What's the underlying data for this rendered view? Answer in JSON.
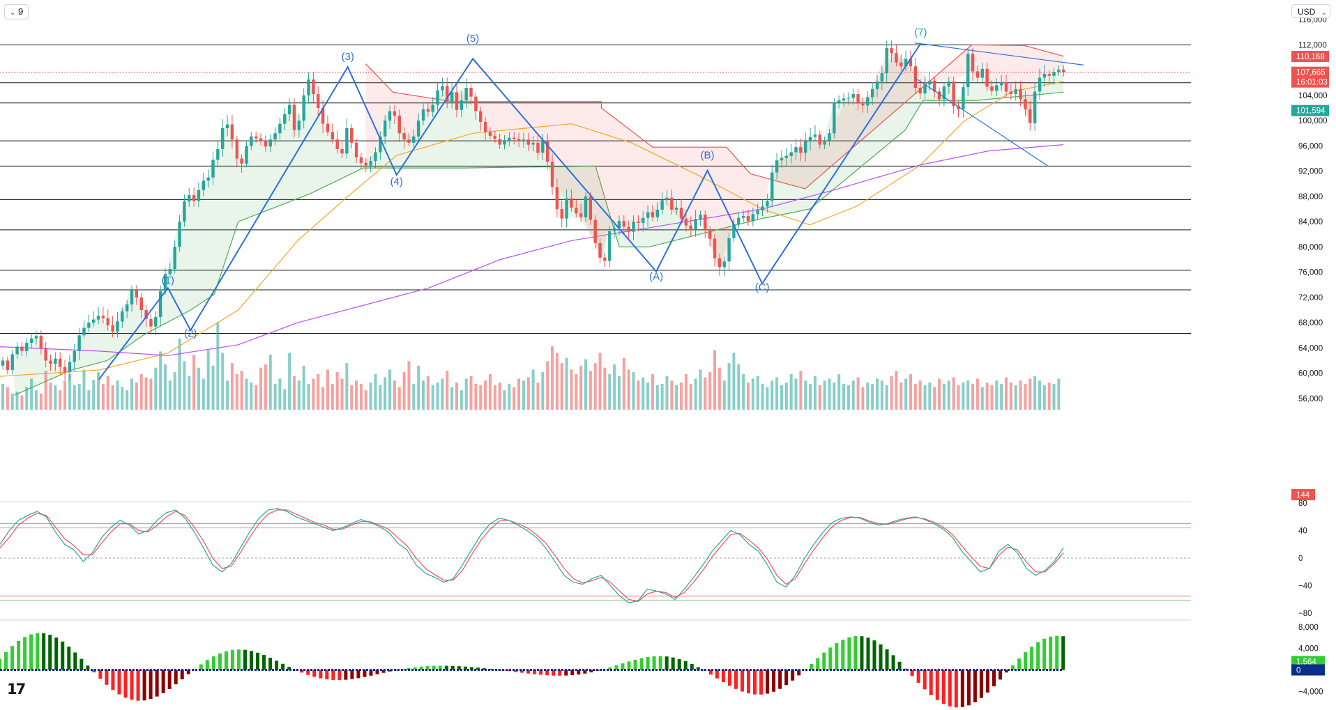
{
  "toolbar": {
    "interval_label": "9",
    "currency_label": "USD"
  },
  "brand": {
    "logo_text": "17"
  },
  "colors": {
    "up": "#26a69a",
    "down": "#ef5350",
    "wave_lines": "#2a6fdb",
    "ma_orange": "#f5a623",
    "ma_purple": "#b84dff",
    "stop_green": "#4caf50",
    "stop_red": "#ef5350",
    "macd_up_strong": "#006400",
    "macd_up": "#32cd32",
    "macd_down_strong": "#8b0000",
    "macd_down": "#ff2020"
  },
  "chart_data": [
    {
      "type": "candlestick",
      "title": "",
      "ylabel": "",
      "ylim": [
        54000,
        118000
      ],
      "y_ticks": [
        "116,000",
        "112,000",
        "108,000",
        "104,000",
        "100,000",
        "96,000",
        "92,000",
        "88,000",
        "84,000",
        "80,000",
        "76,000",
        "72,000",
        "68,000",
        "64,000",
        "60,000",
        "56,000"
      ],
      "horizontal_levels": [
        112000,
        106000,
        102800,
        96800,
        92800,
        87500,
        82700,
        76300,
        73200,
        66300
      ],
      "price_tags": [
        {
          "label": "110,168",
          "value": 110168,
          "color": "#ef5350"
        },
        {
          "label": "107,665",
          "sub_label": "16:01:03",
          "value": 107665,
          "color": "#ef5350"
        },
        {
          "label": "101,594",
          "value": 101594,
          "color": "#26a69a"
        },
        {
          "label": "144",
          "value": 55000,
          "color": "#ef5350"
        }
      ],
      "wave_labels": [
        {
          "label": "(1)",
          "x": 0.141,
          "value": 74200
        },
        {
          "label": "(2)",
          "x": 0.16,
          "value": 65800
        },
        {
          "label": "(3)",
          "x": 0.292,
          "value": 109600
        },
        {
          "label": "(4)",
          "x": 0.333,
          "value": 89800
        },
        {
          "label": "(5)",
          "x": 0.397,
          "value": 112500
        },
        {
          "label": "(A)",
          "x": 0.551,
          "value": 74800
        },
        {
          "label": "(B)",
          "x": 0.594,
          "value": 94000
        },
        {
          "label": "(C)",
          "x": 0.64,
          "value": 73100
        },
        {
          "label": "(7)",
          "x": 0.773,
          "value": 113500
        }
      ],
      "wave_path": [
        [
          0.083,
          59000
        ],
        [
          0.141,
          73500
        ],
        [
          0.16,
          66800
        ],
        [
          0.292,
          108500
        ],
        [
          0.333,
          91400
        ],
        [
          0.397,
          109800
        ],
        [
          0.551,
          76100
        ],
        [
          0.594,
          92100
        ],
        [
          0.64,
          74200
        ],
        [
          0.773,
          112200
        ]
      ],
      "closes": [
        62000,
        60500,
        63000,
        64200,
        63500,
        64800,
        65500,
        65900,
        64000,
        62000,
        61500,
        62300,
        61000,
        60200,
        61800,
        63500,
        66000,
        67200,
        68000,
        68500,
        69100,
        68700,
        67600,
        66600,
        68200,
        69800,
        70900,
        73200,
        72000,
        70000,
        68600,
        67400,
        68900,
        73000,
        75700,
        76500,
        80000,
        84000,
        87200,
        88200,
        87300,
        89000,
        90500,
        91000,
        93800,
        95500,
        98800,
        99400,
        97000,
        94000,
        93200,
        96000,
        97500,
        97200,
        96800,
        95900,
        97000,
        98000,
        99500,
        101000,
        102500,
        98500,
        100000,
        104000,
        106500,
        104200,
        102000,
        99500,
        98200,
        97000,
        95500,
        94800,
        98800,
        96500,
        94200,
        93300,
        92900,
        93600,
        95000,
        97500,
        100000,
        101500,
        100800,
        98000,
        97000,
        96500,
        97500,
        100000,
        101800,
        101400,
        102500,
        104800,
        105500,
        103000,
        104500,
        101700,
        103200,
        105200,
        103800,
        101500,
        99800,
        98200,
        97600,
        97100,
        96200,
        96800,
        97300,
        97100,
        96700,
        97000,
        96200,
        96500,
        94900,
        96700,
        93500,
        89500,
        86000,
        84500,
        87700,
        86200,
        85300,
        84700,
        88000,
        84300,
        80600,
        78300,
        77800,
        82500,
        83000,
        84100,
        83200,
        82400,
        84000,
        83800,
        84600,
        85500,
        84700,
        85900,
        87400,
        87800,
        85900,
        86200,
        84500,
        83400,
        82700,
        84400,
        85100,
        82600,
        81300,
        78200,
        76800,
        77700,
        81400,
        83600,
        84600,
        84900,
        84100,
        85200,
        85800,
        86400,
        87300,
        91800,
        93700,
        94100,
        94400,
        95000,
        95800,
        94900,
        96700,
        97400,
        97800,
        96200,
        96800,
        98000,
        102800,
        103200,
        103500,
        103600,
        104200,
        102700,
        102400,
        103700,
        105000,
        106200,
        107500,
        111500,
        110700,
        109200,
        108600,
        109800,
        108600,
        105200,
        104300,
        105700,
        106300,
        104600,
        103400,
        105400,
        106200,
        102300,
        101800,
        105300,
        110600,
        107800,
        106800,
        108200,
        105400,
        104700,
        105600,
        106100,
        104600,
        104200,
        105000,
        103400,
        101800,
        99600,
        104600,
        106800,
        107400,
        107100,
        107700,
        108100,
        107665
      ],
      "ma_orange": [
        [
          0.0,
          59500
        ],
        [
          0.083,
          60500
        ],
        [
          0.141,
          63200
        ],
        [
          0.2,
          70000
        ],
        [
          0.25,
          81000
        ],
        [
          0.292,
          88000
        ],
        [
          0.333,
          94500
        ],
        [
          0.397,
          98000
        ],
        [
          0.48,
          99500
        ],
        [
          0.53,
          96500
        ],
        [
          0.59,
          91000
        ],
        [
          0.64,
          86000
        ],
        [
          0.68,
          83500
        ],
        [
          0.72,
          86500
        ],
        [
          0.773,
          93000
        ],
        [
          0.81,
          100000
        ],
        [
          0.85,
          104600
        ],
        [
          0.893,
          106200
        ]
      ],
      "ma_purple": [
        [
          0.0,
          64200
        ],
        [
          0.083,
          63500
        ],
        [
          0.141,
          62800
        ],
        [
          0.2,
          64500
        ],
        [
          0.25,
          68000
        ],
        [
          0.3,
          70500
        ],
        [
          0.36,
          73500
        ],
        [
          0.42,
          78000
        ],
        [
          0.48,
          81000
        ],
        [
          0.56,
          83500
        ],
        [
          0.64,
          86000
        ],
        [
          0.7,
          89000
        ],
        [
          0.773,
          93000
        ],
        [
          0.83,
          95200
        ],
        [
          0.893,
          96200
        ]
      ],
      "volume_ylim": [
        0,
        200000
      ],
      "volumes": [
        40,
        35,
        25,
        28,
        22,
        35,
        48,
        30,
        25,
        60,
        42,
        38,
        30,
        45,
        55,
        38,
        40,
        62,
        30,
        46,
        58,
        40,
        52,
        38,
        45,
        35,
        30,
        48,
        42,
        55,
        50,
        48,
        65,
        90,
        70,
        45,
        58,
        110,
        75,
        52,
        85,
        65,
        48,
        92,
        68,
        135,
        88,
        45,
        72,
        55,
        60,
        48,
        42,
        38,
        65,
        70,
        85,
        40,
        48,
        32,
        88,
        52,
        45,
        68,
        40,
        48,
        55,
        35,
        62,
        40,
        58,
        48,
        72,
        38,
        45,
        40,
        30,
        42,
        55,
        38,
        50,
        62,
        45,
        35,
        58,
        75,
        40,
        68,
        45,
        52,
        38,
        42,
        48,
        60,
        35,
        42,
        30,
        48,
        52,
        40,
        38,
        45,
        55,
        38,
        42,
        30,
        40,
        35,
        48,
        45,
        50,
        62,
        42,
        58,
        75,
        98,
        88,
        72,
        80,
        62,
        55,
        68,
        78,
        60,
        72,
        88,
        65,
        55,
        70,
        52,
        80,
        62,
        58,
        45,
        50,
        42,
        55,
        38,
        40,
        52,
        45,
        38,
        42,
        55,
        40,
        48,
        62,
        50,
        58,
        92,
        65,
        45,
        72,
        88,
        70,
        55,
        42,
        48,
        52,
        40,
        35,
        45,
        50,
        38,
        42,
        55,
        48,
        60,
        45,
        40,
        52,
        38,
        45,
        48,
        42,
        55,
        40,
        38,
        45,
        50,
        35,
        42,
        40,
        48,
        45,
        38,
        52,
        60,
        42,
        48,
        55,
        40,
        45,
        38,
        42,
        35,
        48,
        40,
        45,
        50,
        38,
        42,
        45,
        40,
        48,
        35,
        42,
        38,
        45,
        40,
        50,
        42,
        38,
        45,
        40,
        48,
        52,
        45,
        38,
        42,
        40,
        48
      ],
      "stop_line_green": [
        [
          0.012,
          56500
        ],
        [
          0.06,
          60500
        ],
        [
          0.09,
          62000
        ],
        [
          0.12,
          66000
        ],
        [
          0.16,
          70000
        ],
        [
          0.18,
          72500
        ],
        [
          0.2,
          84000
        ],
        [
          0.26,
          88400
        ],
        [
          0.305,
          92500
        ],
        [
          0.39,
          92500
        ],
        [
          0.5,
          92800
        ],
        [
          0.52,
          80000
        ],
        [
          0.545,
          80000
        ],
        [
          0.64,
          84500
        ],
        [
          0.68,
          86000
        ],
        [
          0.76,
          98500
        ],
        [
          0.775,
          103200
        ],
        [
          0.82,
          103200
        ],
        [
          0.893,
          104500
        ]
      ],
      "stop_line_red": [
        [
          0.307,
          109000
        ],
        [
          0.33,
          104500
        ],
        [
          0.38,
          103000
        ],
        [
          0.505,
          103000
        ],
        [
          0.505,
          102000
        ],
        [
          0.548,
          95800
        ],
        [
          0.61,
          95800
        ],
        [
          0.63,
          91600
        ],
        [
          0.676,
          89200
        ],
        [
          0.816,
          112000
        ],
        [
          0.86,
          111900
        ],
        [
          0.893,
          110200
        ]
      ],
      "triangle_upper": [
        [
          0.768,
          112300
        ],
        [
          0.91,
          108800
        ]
      ],
      "triangle_lower": [
        [
          0.768,
          106800
        ],
        [
          0.88,
          92800
        ]
      ]
    },
    {
      "type": "line",
      "name": "stochastic",
      "ylim": [
        -80,
        80
      ],
      "y_ticks": [
        "80",
        "40",
        "0",
        "−40",
        "−80"
      ],
      "levels": [
        50,
        -55
      ],
      "k": [
        20,
        40,
        55,
        62,
        68,
        60,
        38,
        20,
        12,
        -5,
        8,
        30,
        45,
        55,
        48,
        35,
        40,
        55,
        66,
        70,
        58,
        38,
        15,
        -10,
        -20,
        -8,
        15,
        38,
        58,
        70,
        72,
        68,
        60,
        55,
        50,
        45,
        40,
        44,
        50,
        56,
        52,
        46,
        38,
        22,
        12,
        -10,
        -22,
        -28,
        -35,
        -30,
        -10,
        12,
        34,
        50,
        58,
        55,
        48,
        40,
        30,
        15,
        -5,
        -25,
        -35,
        -38,
        -30,
        -25,
        -40,
        -55,
        -65,
        -62,
        -45,
        -48,
        -52,
        -60,
        -45,
        -28,
        -10,
        10,
        25,
        40,
        34,
        20,
        10,
        -10,
        -35,
        -42,
        -25,
        0,
        20,
        38,
        52,
        58,
        60,
        58,
        52,
        48,
        50,
        55,
        58,
        60,
        56,
        50,
        42,
        30,
        10,
        -5,
        -20,
        -15,
        10,
        20,
        8,
        -15,
        -25,
        -18,
        -5,
        15
      ],
      "d": [
        15,
        30,
        48,
        58,
        65,
        62,
        45,
        28,
        18,
        5,
        5,
        22,
        38,
        50,
        50,
        40,
        38,
        48,
        60,
        68,
        62,
        45,
        25,
        0,
        -15,
        -12,
        8,
        30,
        50,
        64,
        70,
        70,
        64,
        58,
        52,
        48,
        42,
        42,
        48,
        53,
        53,
        48,
        42,
        30,
        18,
        0,
        -15,
        -24,
        -32,
        -32,
        -18,
        5,
        26,
        42,
        54,
        55,
        50,
        44,
        34,
        22,
        4,
        -15,
        -30,
        -36,
        -33,
        -28,
        -35,
        -48,
        -60,
        -63,
        -52,
        -48,
        -50,
        -57,
        -50,
        -35,
        -18,
        2,
        18,
        34,
        36,
        26,
        15,
        -2,
        -25,
        -38,
        -30,
        -8,
        12,
        30,
        46,
        55,
        59,
        59,
        54,
        50,
        49,
        53,
        57,
        59,
        57,
        52,
        45,
        34,
        18,
        2,
        -12,
        -15,
        4,
        16,
        12,
        -6,
        -20,
        -20,
        -8,
        8
      ]
    },
    {
      "type": "bar",
      "name": "macd_histogram",
      "ylim": [
        -5000,
        8500
      ],
      "y_ticks": [
        "8,000",
        "4,000",
        "0",
        "−4,000"
      ],
      "price_tags": [
        {
          "label": "1,564",
          "value": 1564,
          "color": "#32cd32"
        },
        {
          "label": "0",
          "value": 0,
          "color": "#0d2d8a"
        }
      ]
    }
  ]
}
